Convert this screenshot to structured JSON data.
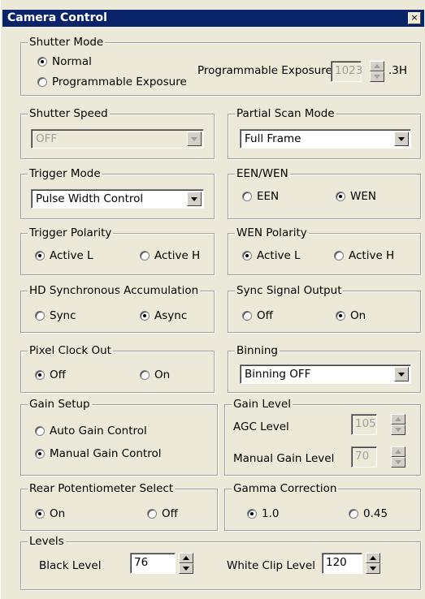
{
  "window": {
    "title": "Camera Control",
    "close_label": "×"
  },
  "shutter_mode": {
    "legend": "Shutter Mode",
    "options": [
      "Normal",
      "Programmable Exposure"
    ],
    "selected": "Normal",
    "prog_exposure_label": "Programmable Exposure",
    "prog_exposure_value": "1023",
    "prog_exposure_unit": ".3H"
  },
  "shutter_speed": {
    "legend": "Shutter Speed",
    "value": "OFF"
  },
  "partial_scan": {
    "legend": "Partial Scan Mode",
    "value": "Full Frame"
  },
  "trigger_mode": {
    "legend": "Trigger Mode",
    "value": "Pulse Width Control"
  },
  "een_wen": {
    "legend": "EEN/WEN",
    "options": [
      "EEN",
      "WEN"
    ],
    "selected": "WEN"
  },
  "trigger_polarity": {
    "legend": "Trigger Polarity",
    "options": [
      "Active L",
      "Active H"
    ],
    "selected": "Active L"
  },
  "wen_polarity": {
    "legend": "WEN Polarity",
    "options": [
      "Active L",
      "Active H"
    ],
    "selected": "Active L"
  },
  "hd_sync": {
    "legend": "HD Synchronous Accumulation",
    "options": [
      "Sync",
      "Async"
    ],
    "selected": "Async"
  },
  "sync_output": {
    "legend": "Sync Signal Output",
    "options": [
      "Off",
      "On"
    ],
    "selected": "On"
  },
  "pixel_clock": {
    "legend": "Pixel Clock Out",
    "options": [
      "Off",
      "On"
    ],
    "selected": "Off"
  },
  "binning": {
    "legend": "Binning",
    "value": "Binning OFF"
  },
  "gain_setup": {
    "legend": "Gain Setup",
    "options": [
      "Auto Gain Control",
      "Manual Gain Control"
    ],
    "selected": "Manual Gain Control"
  },
  "gain_level": {
    "legend": "Gain Level",
    "agc_label": "AGC Level",
    "agc_value": "105",
    "manual_label": "Manual Gain Level",
    "manual_value": "70"
  },
  "rear_pot": {
    "legend": "Rear Potentiometer Select",
    "options": [
      "On",
      "Off"
    ],
    "selected": "On"
  },
  "gamma": {
    "legend": "Gamma Correction",
    "options": [
      "1.0",
      "0.45"
    ],
    "selected": "1.0"
  },
  "levels": {
    "legend": "Levels",
    "black_label": "Black Level",
    "black_value": "76",
    "white_label": "White Clip Level",
    "white_value": "120"
  }
}
